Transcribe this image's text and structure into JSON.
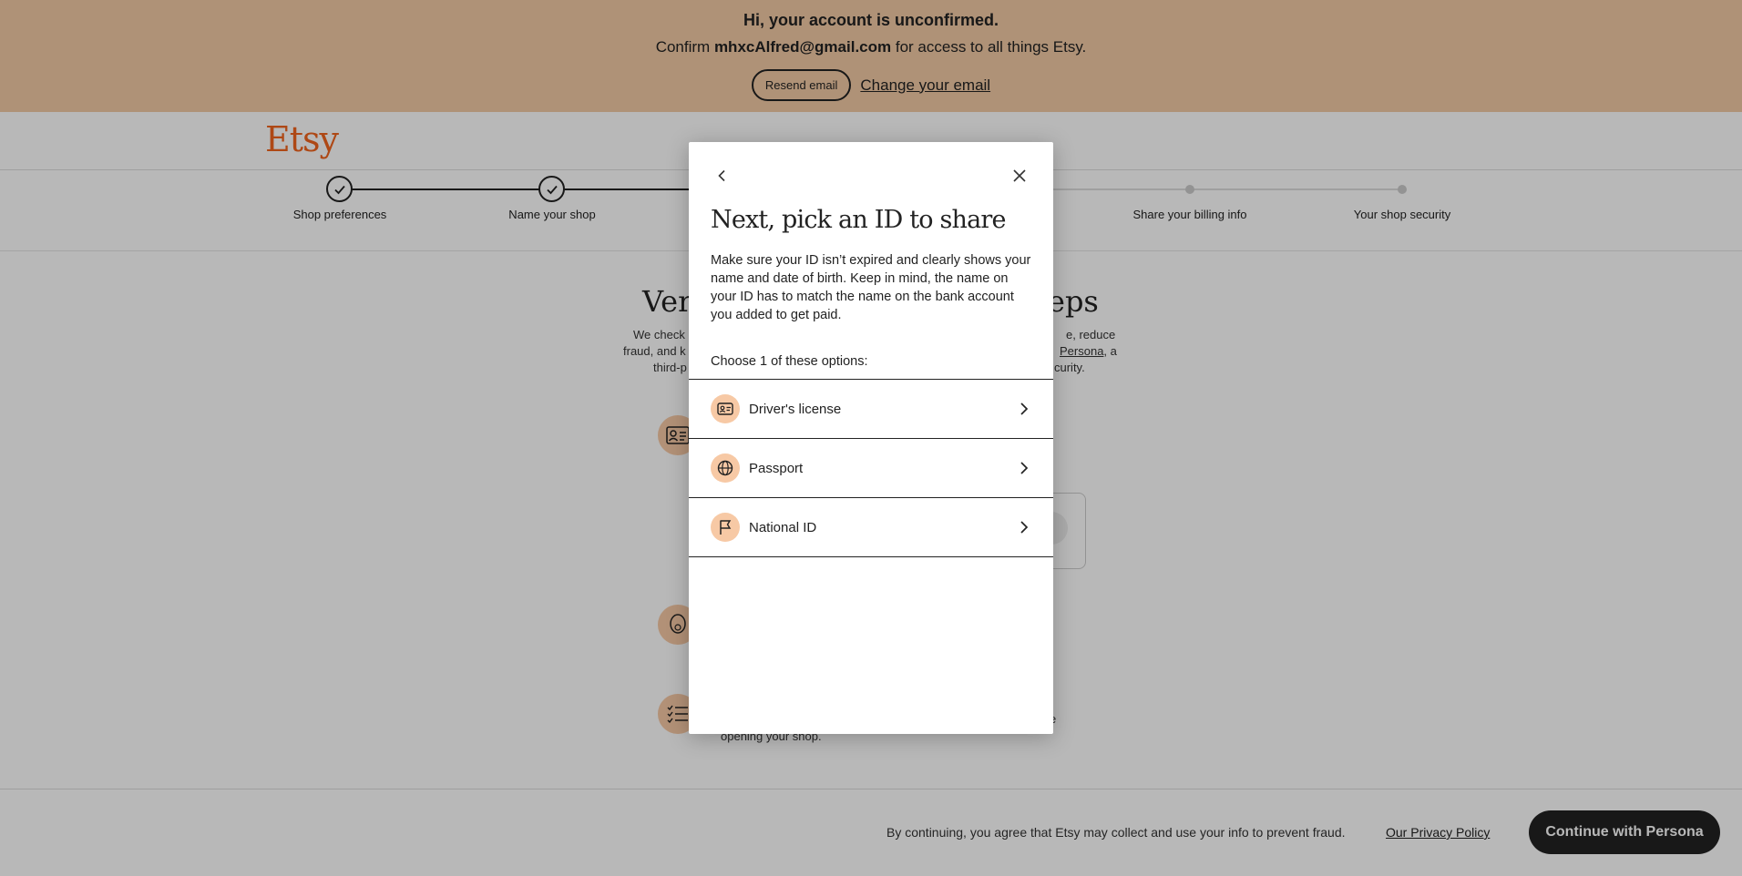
{
  "banner": {
    "title": "Hi, your account is unconfirmed.",
    "msg_prefix": "Confirm ",
    "email": "mhxcAlfred@gmail.com",
    "msg_suffix": " for access to all things Etsy.",
    "resend_label": "Resend email",
    "change_label": "Change your email"
  },
  "header": {
    "logo": "Etsy"
  },
  "stepper": {
    "steps": [
      {
        "label": "Shop preferences",
        "state": "done"
      },
      {
        "label": "Name your shop",
        "state": "done"
      },
      {
        "label": "Share your billing info",
        "state": "todo"
      },
      {
        "label": "Your shop security",
        "state": "todo"
      }
    ]
  },
  "background": {
    "heading_left": "Veri",
    "heading_right": "eps",
    "para_left_1": "We check",
    "para_right_1": "e, reduce",
    "para_left_2": "fraud, and k",
    "para_right_2_link": "Persona",
    "para_right_2_suffix": ", a",
    "para_left_3": "third-p",
    "para_right_3": "curity.",
    "bottom_text": "opening your shop.",
    "bottom_right_fragment": "e"
  },
  "modal": {
    "title": "Next, pick an ID to share",
    "description": "Make sure your ID isn’t expired and clearly shows your name and date of birth. Keep in mind, the name on your ID has to match the name on the bank account you added to get paid.",
    "choose": "Choose 1 of these options:",
    "options": [
      {
        "label": "Driver's license",
        "icon": "id-card-icon"
      },
      {
        "label": "Passport",
        "icon": "globe-icon"
      },
      {
        "label": "National ID",
        "icon": "flag-icon"
      }
    ]
  },
  "footer": {
    "consent": "By continuing, you agree that Etsy may collect and use your info to prevent fraud.",
    "privacy_link": "Our Privacy Policy",
    "continue_label": "Continue with Persona"
  },
  "colors": {
    "banner_bg": "#f3cba6",
    "brand": "#f1641e",
    "icon_bg": "#f7c9a5",
    "button_dark": "#222222"
  }
}
